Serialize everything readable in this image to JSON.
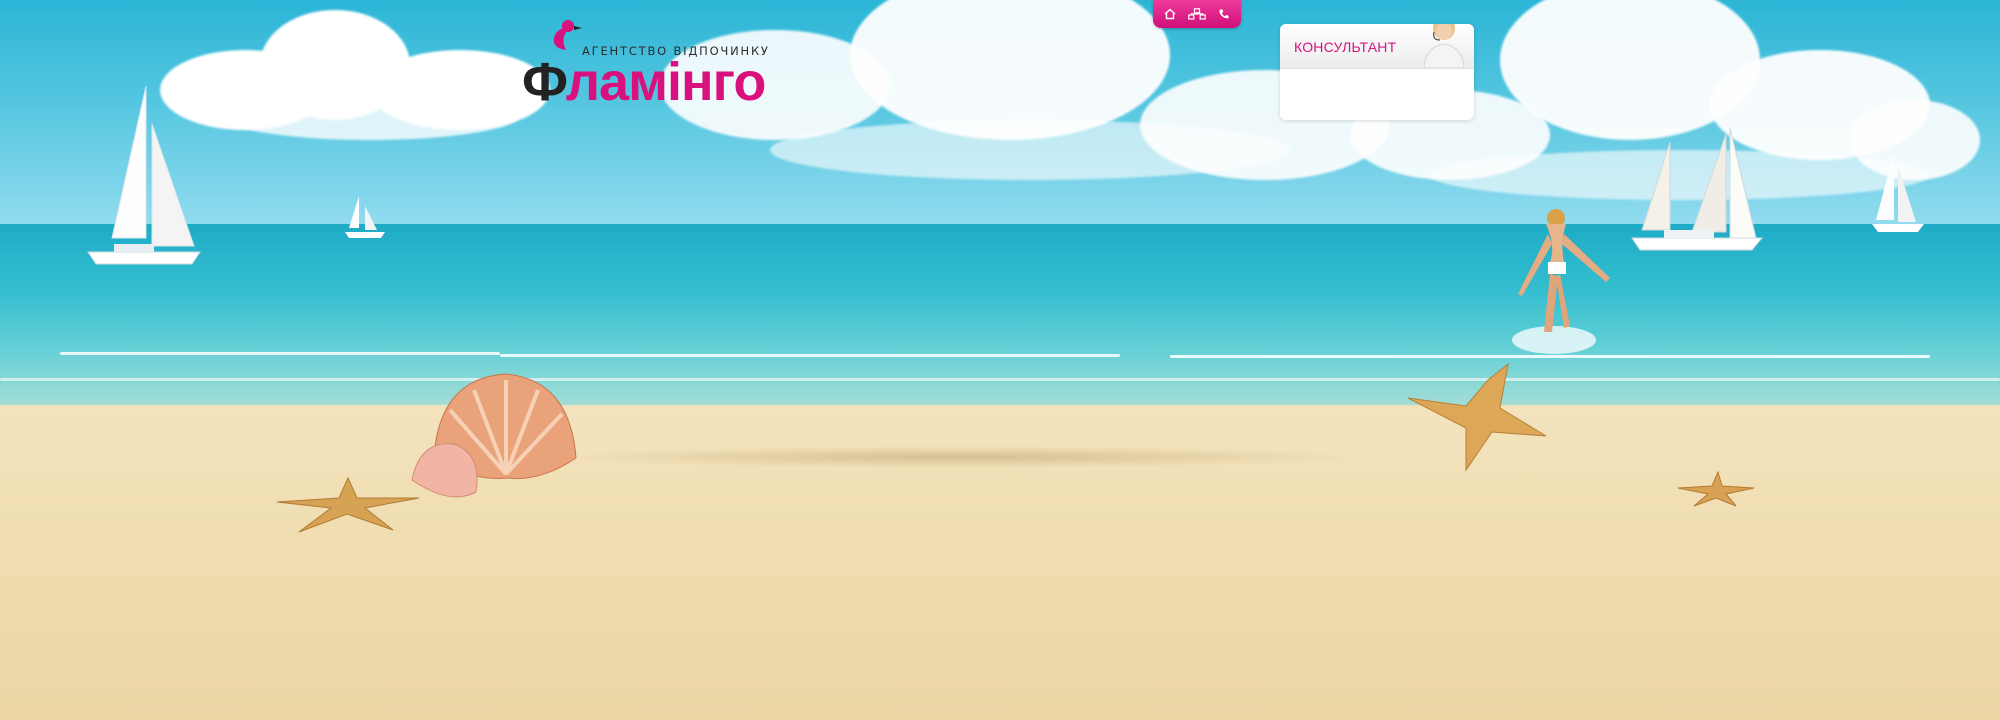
{
  "logo": {
    "tagline": "АГЕНТСТВО ВІДПОЧИНКУ",
    "name_first": "Ф",
    "name_rest": "ламінго"
  },
  "topnav": {
    "items": [
      {
        "icon": "home-icon"
      },
      {
        "icon": "group-icon"
      },
      {
        "icon": "phone-icon"
      }
    ]
  },
  "consultant": {
    "title": "КОНСУЛЬТАНТ"
  },
  "colors": {
    "brand_pink": "#d9117e",
    "sky": "#2bb5d6",
    "sea": "#36bfd0",
    "sand": "#f0ddb2"
  }
}
